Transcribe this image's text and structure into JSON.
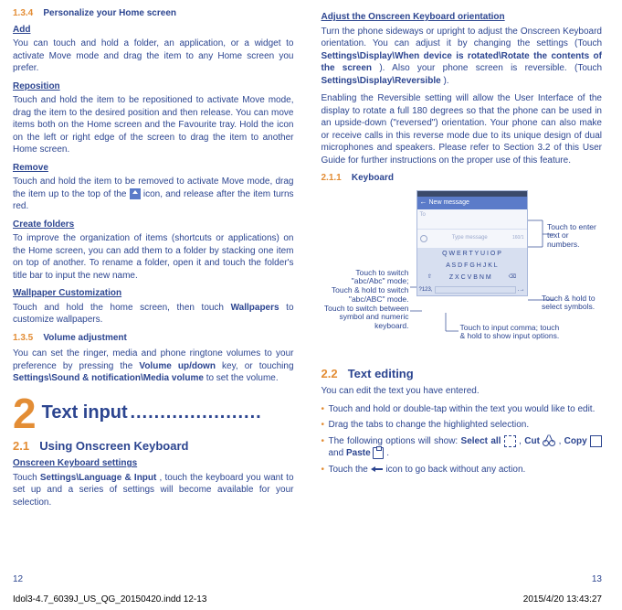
{
  "left": {
    "sec134_num": "1.3.4",
    "sec134_title": "Personalize your Home screen",
    "add_head": "Add",
    "add_body": "You can touch and hold a folder, an application, or a widget to activate Move mode and drag the item to any Home screen you prefer.",
    "reposition_head": "Reposition",
    "reposition_body": "Touch and hold the item to be repositioned to activate Move mode, drag the item to the desired position and then release. You can move items both on the Home screen and the Favourite tray. Hold the icon on the left or right edge of the screen to drag the item to another Home screen.",
    "remove_head": "Remove",
    "remove_body1": "Touch and hold the item to be removed to activate Move mode, drag the item up to the top of the ",
    "remove_body2": " icon, and release after the item turns red.",
    "create_head": "Create folders",
    "create_body": "To improve the organization of items (shortcuts or applications) on the Home screen, you can add them to a folder by stacking one item on top of another. To rename a folder, open it and touch the folder's title bar to input the new name.",
    "wall_head": "Wallpaper Customization",
    "wall_body1": "Touch and hold the home screen, then touch ",
    "wall_bold": "Wallpapers",
    "wall_body2": " to customize wallpapers.",
    "sec135_num": "1.3.5",
    "sec135_title": "Volume adjustment",
    "vol_body1": "You can set the ringer, media and phone ringtone volumes to your preference by pressing the ",
    "vol_bold1": "Volume up/down",
    "vol_body2": " key, or touching ",
    "vol_bold2": "Settings\\Sound & notification\\Media volume",
    "vol_body3": " to set the volume.",
    "big2_num": "2",
    "big2_txt": "Text input",
    "big2_dots": "......................",
    "h21_num": "2.1",
    "h21_txt": "Using Onscreen Keyboard",
    "okb_head": "Onscreen Keyboard settings",
    "okb_body1": "Touch ",
    "okb_bold": "Settings\\Language & Input",
    "okb_body2": ", touch the keyboard you want to set up and a series of settings will become available for your selection.",
    "page_num": "12"
  },
  "right": {
    "adjust_head": "Adjust the Onscreen Keyboard orientation",
    "adjust_body1": "Turn the phone sideways or upright to adjust the Onscreen Keyboard orientation. You can adjust it by changing the settings (Touch ",
    "adjust_bold1": "Settings\\Display\\When device is rotated\\Rotate the contents of the screen",
    "adjust_body2": "). Also your phone screen is reversible. (Touch ",
    "adjust_bold2": "Settings\\Display\\Reversible",
    "adjust_body3": ").",
    "enabling_body": "Enabling the Reversible setting will allow the User Interface of the display to rotate a full 180 degrees so that the phone can be used in an upside-down (\"reversed\") orientation. Your phone can also make or receive calls in this reverse mode due to its unique design of dual microphones and speakers. Please refer to Section 3.2 of this User Guide for further instructions on the proper use of this feature.",
    "sec211_num": "2.1.1",
    "sec211_title": "Keyboard",
    "phone": {
      "header_label": "New message",
      "to_label": "To",
      "msg_placeholder": "Type message",
      "kb_row1": "Q W E R T Y U I O P",
      "kb_row2": "A S D F G H J K L",
      "kb_row3": "Z X C V B N M",
      "kb_bottom_left": "?123",
      "kb_bottom_comma": ",",
      "kb_bottom_dot": ".",
      "kb_bottom_send": "→"
    },
    "callouts": {
      "enter": "Touch to enter text or numbers.",
      "abc1": "Touch to switch \"abc/Abc\" mode;",
      "abc2": "Touch & hold to switch \"abc/ABC\" mode.",
      "sym": "Touch to switch between symbol and numeric keyboard.",
      "hold_sym": "Touch & hold to select symbols.",
      "comma": "Touch to input comma; touch & hold to show input options."
    },
    "h22_num": "2.2",
    "h22_txt": "Text editing",
    "edit_intro": "You can edit the text you have entered.",
    "b1": "Touch and hold or double-tap within the text you would like to edit.",
    "b2": "Drag the tabs to change the highlighted selection.",
    "b3a": "The following options will show: ",
    "b3_select": "Select all",
    "b3_comma": " , ",
    "b3_cut": "Cut",
    "b3_copy": "Copy",
    "b3_and": " and ",
    "b3_paste": "Paste",
    "b3_dot": " .",
    "b4a": "Touch the ",
    "b4b": " icon to go back without any action.",
    "page_num": "13"
  },
  "meta": {
    "file": "Idol3-4.7_6039J_US_QG_20150420.indd   12-13",
    "date": "2015/4/20   13:43:27"
  }
}
